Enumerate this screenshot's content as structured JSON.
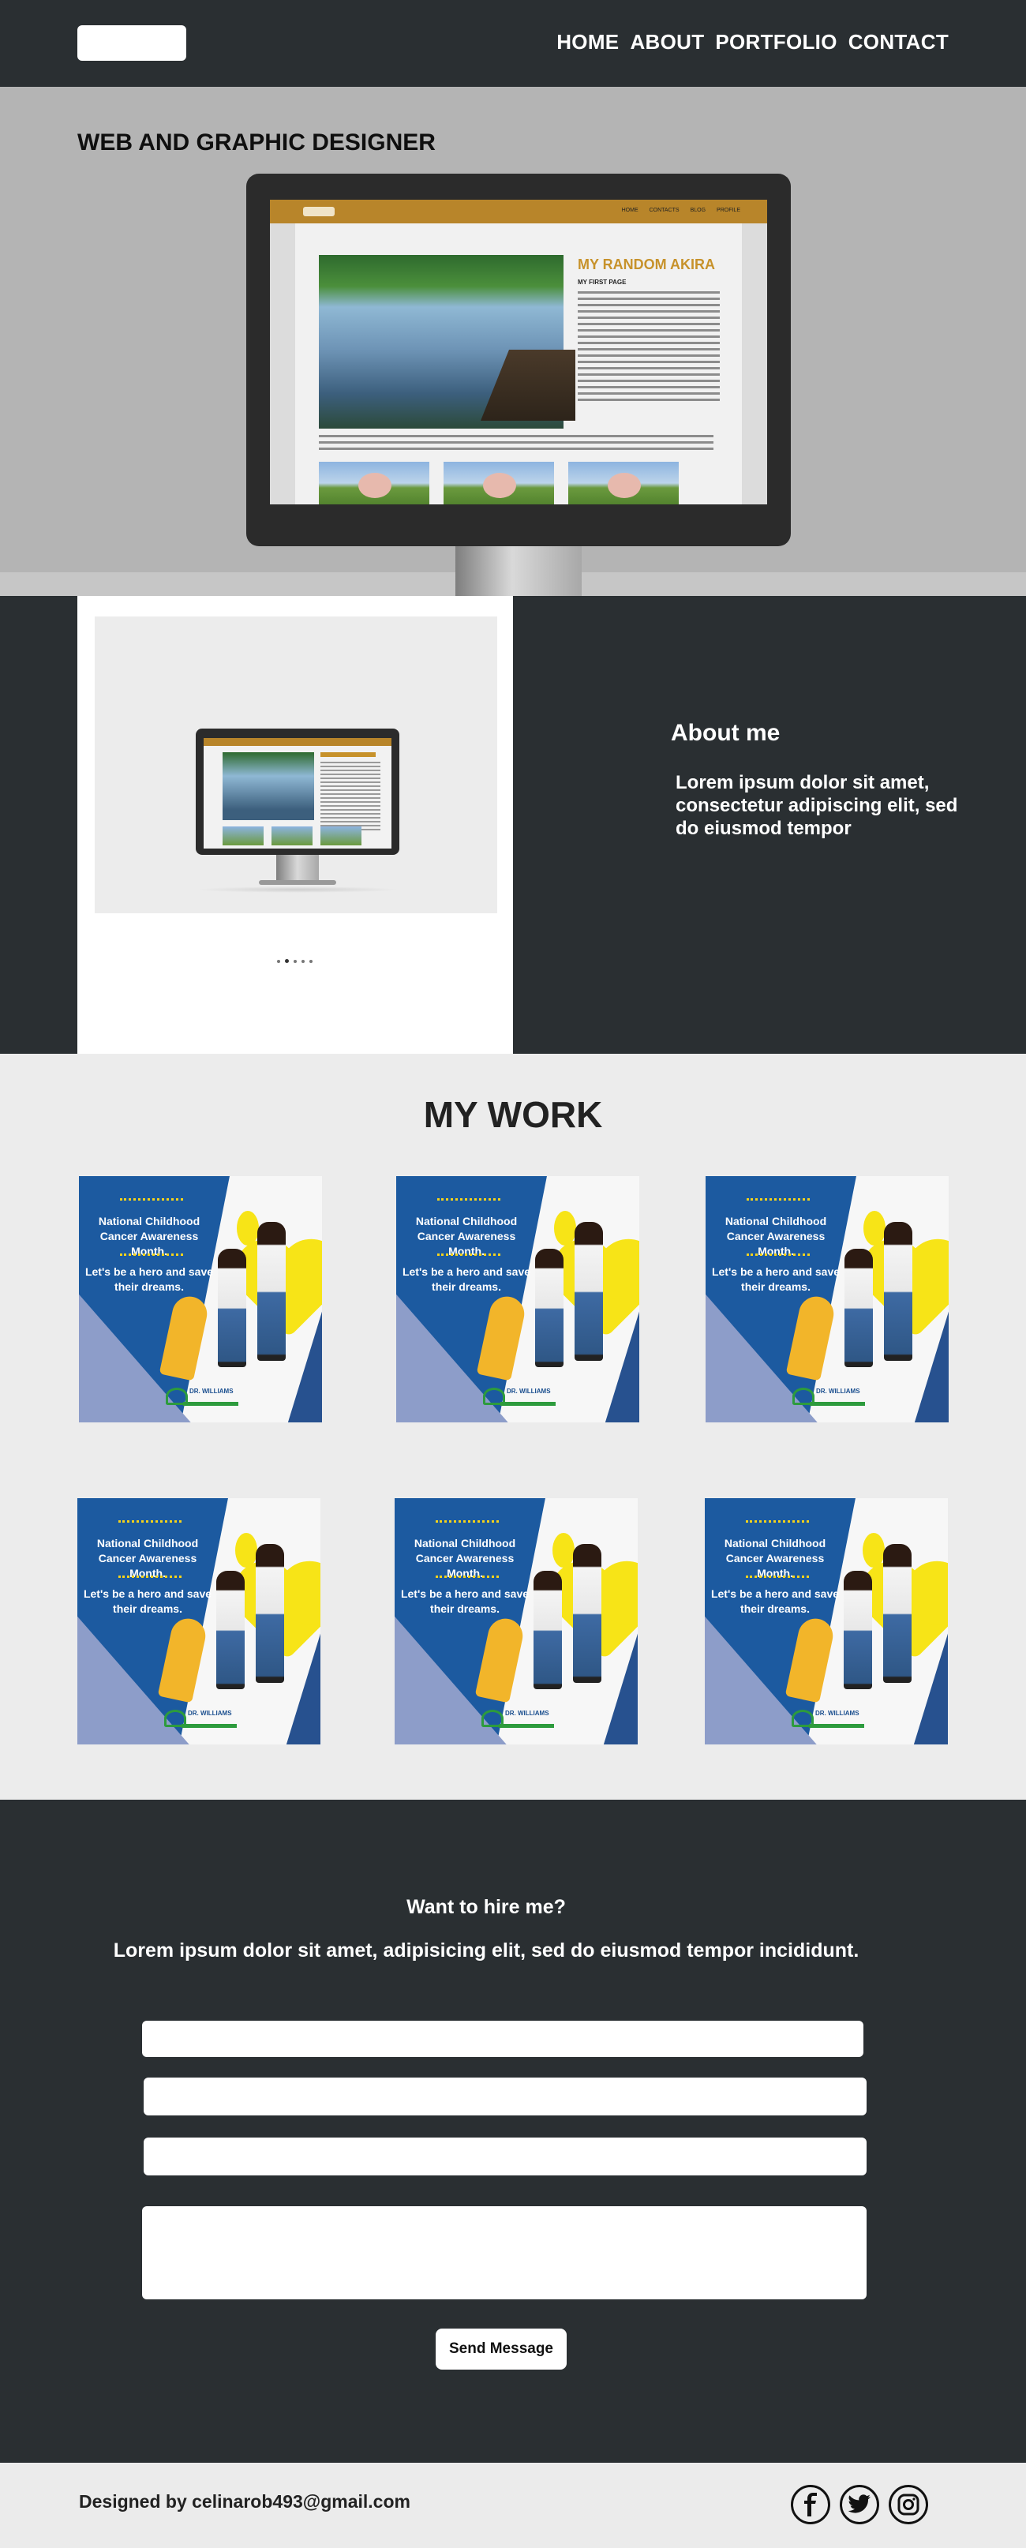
{
  "nav": {
    "links": [
      "HOME",
      "ABOUT",
      "PORTFOLIO",
      "CONTACT"
    ]
  },
  "hero": {
    "title": "WEB AND GRAPHIC DESIGNER",
    "mockup": {
      "heading": "MY RANDOM AKIRA",
      "subheading": "MY FIRST PAGE",
      "nav": [
        "HOME",
        "CONTACTS",
        "BLOG",
        "PROFILE"
      ]
    }
  },
  "about": {
    "heading": "About me",
    "text": "Lorem ipsum dolor sit amet, consectetur adipiscing elit, sed do eiusmod tempor"
  },
  "work": {
    "title": "MY WORK",
    "poster": {
      "line1": "National Childhood Cancer Awareness Month.",
      "line2": "Let's be a hero and save their dreams.",
      "brand": "DR. WILLIAMS"
    }
  },
  "contact": {
    "title": "Want to hire me?",
    "text": "Lorem ipsum dolor sit amet,  adipisicing elit, sed do eiusmod tempor incididunt.",
    "send_label": "Send Message"
  },
  "footer": {
    "text": "Designed by celinarob493@gmail.com",
    "social_icons": [
      "facebook-icon",
      "twitter-icon",
      "instagram-icon"
    ]
  },
  "colors": {
    "dark_bg": "#2a2f32",
    "accent_gold": "#b8852a",
    "poster_blue": "#1c5aa0",
    "poster_yellow": "#f7e417"
  }
}
